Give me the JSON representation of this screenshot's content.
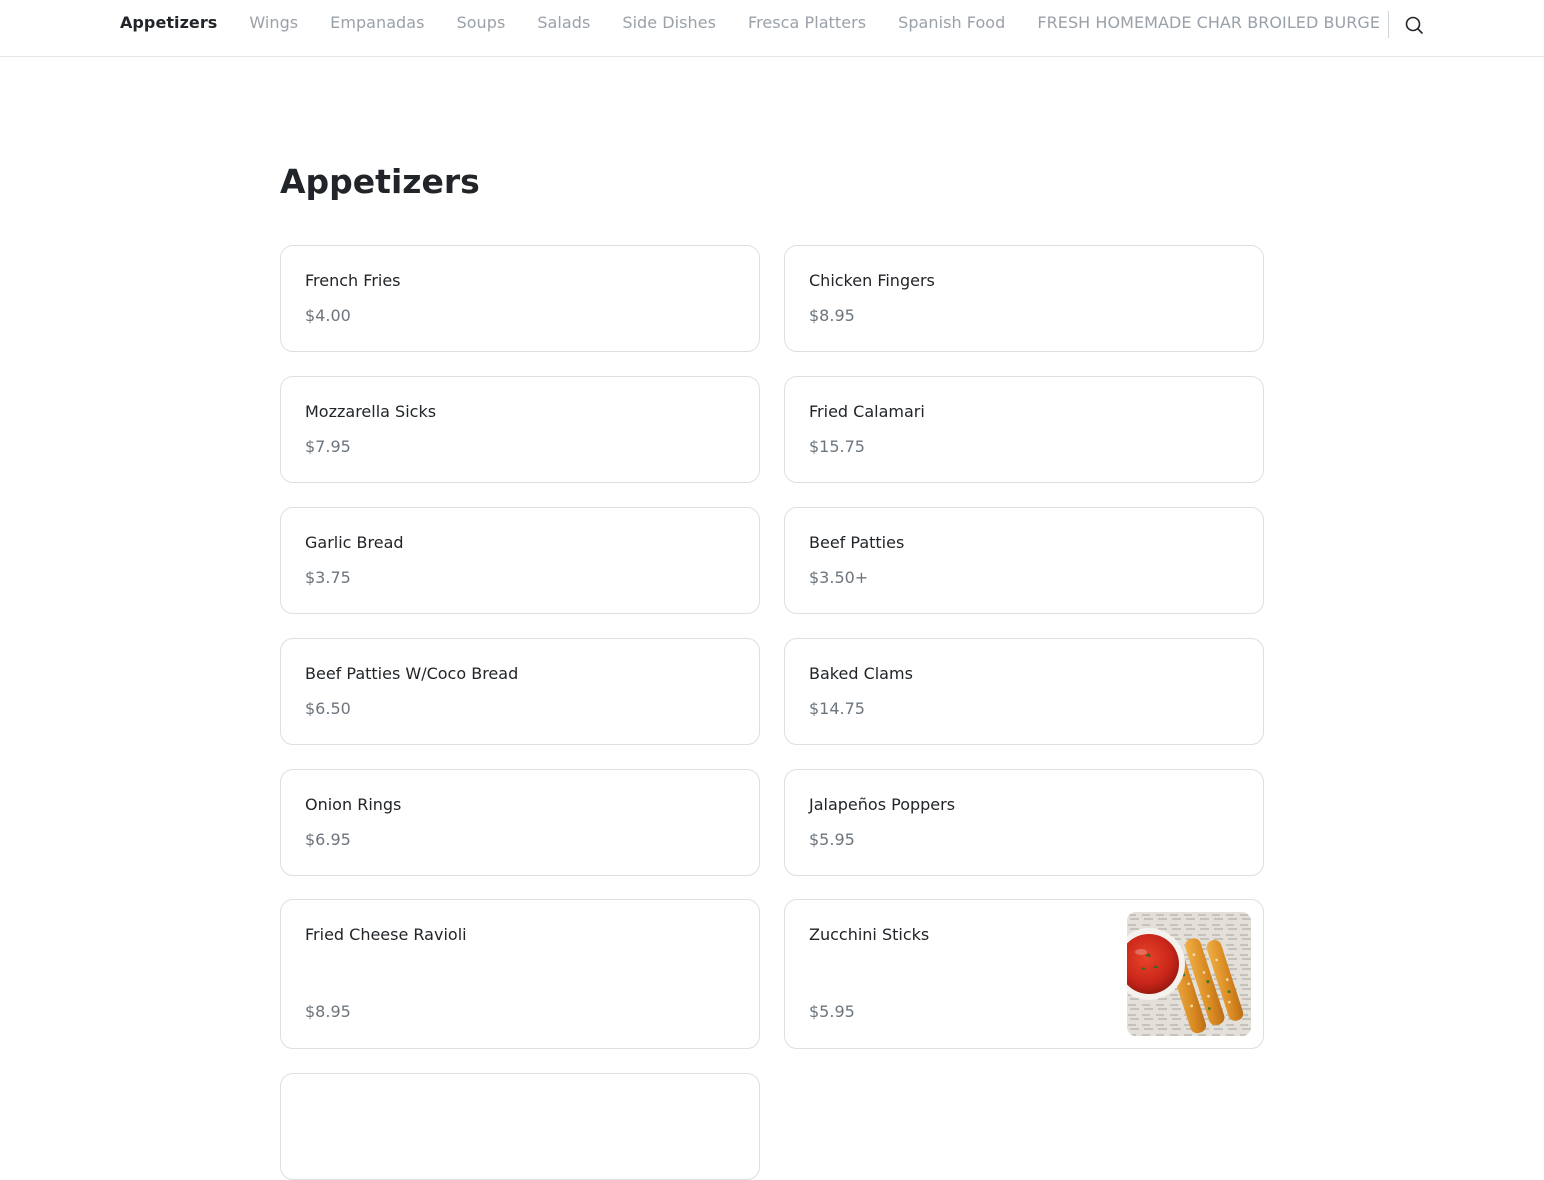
{
  "nav": {
    "categories": [
      {
        "label": "Appetizers",
        "active": true
      },
      {
        "label": "Wings",
        "active": false
      },
      {
        "label": "Empanadas",
        "active": false
      },
      {
        "label": "Soups",
        "active": false
      },
      {
        "label": "Salads",
        "active": false
      },
      {
        "label": "Side Dishes",
        "active": false
      },
      {
        "label": "Fresca Platters",
        "active": false
      },
      {
        "label": "Spanish Food",
        "active": false
      },
      {
        "label": "FRESH HOMEMADE CHAR BROILED BURGE",
        "active": false
      }
    ],
    "search_icon": "search-icon"
  },
  "section": {
    "title": "Appetizers"
  },
  "items": [
    {
      "name": "French Fries",
      "price": "$4.00"
    },
    {
      "name": "Chicken Fingers",
      "price": "$8.95"
    },
    {
      "name": "Mozzarella Sicks",
      "price": "$7.95"
    },
    {
      "name": "Fried Calamari",
      "price": "$15.75"
    },
    {
      "name": "Garlic Bread",
      "price": "$3.75"
    },
    {
      "name": "Beef Patties",
      "price": "$3.50+"
    },
    {
      "name": "Beef Patties W/Coco Bread",
      "price": "$6.50"
    },
    {
      "name": "Baked Clams",
      "price": "$14.75"
    },
    {
      "name": "Onion Rings",
      "price": "$6.95"
    },
    {
      "name": "Jalapeños Poppers",
      "price": "$5.95"
    },
    {
      "name": "Fried Cheese Ravioli",
      "price": "$8.95"
    },
    {
      "name": "Zucchini Sticks",
      "price": "$5.95",
      "image": "zucchini-sticks-photo"
    }
  ],
  "colors": {
    "text": "#212529",
    "muted": "#6c757d",
    "nav_inactive": "#9aa1a8",
    "border": "#dcdfe3"
  }
}
